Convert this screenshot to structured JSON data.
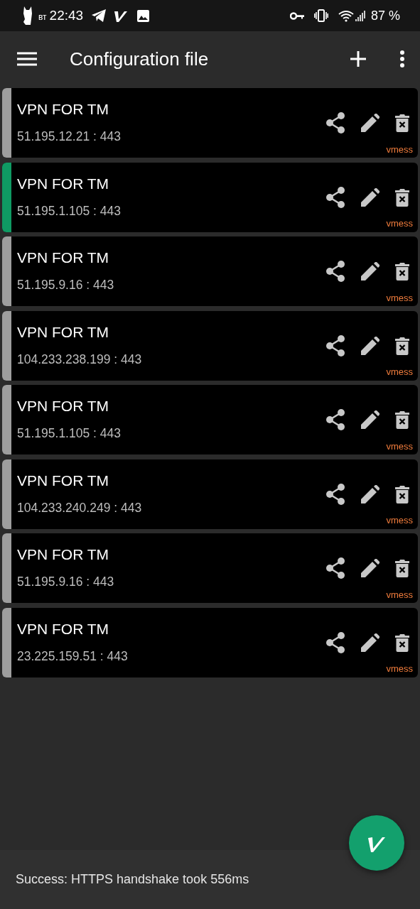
{
  "status_bar": {
    "day": "вт",
    "time": "22:43",
    "battery": "87 %"
  },
  "app_bar": {
    "title": "Configuration file"
  },
  "servers": [
    {
      "name": "VPN FOR TM",
      "address": "51.195.12.21 : 443",
      "protocol": "vmess",
      "selected": false
    },
    {
      "name": "VPN FOR TM",
      "address": "51.195.1.105 : 443",
      "protocol": "vmess",
      "selected": true
    },
    {
      "name": "VPN FOR TM",
      "address": "51.195.9.16 : 443",
      "protocol": "vmess",
      "selected": false
    },
    {
      "name": "VPN FOR TM",
      "address": "104.233.238.199 : 443",
      "protocol": "vmess",
      "selected": false
    },
    {
      "name": "VPN FOR TM",
      "address": "51.195.1.105 : 443",
      "protocol": "vmess",
      "selected": false
    },
    {
      "name": "VPN FOR TM",
      "address": "104.233.240.249 : 443",
      "protocol": "vmess",
      "selected": false
    },
    {
      "name": "VPN FOR TM",
      "address": "51.195.9.16 : 443",
      "protocol": "vmess",
      "selected": false
    },
    {
      "name": "VPN FOR TM",
      "address": "23.225.159.51 : 443",
      "protocol": "vmess",
      "selected": false
    }
  ],
  "snackbar": {
    "message": "Success: HTTPS handshake took 556ms"
  }
}
